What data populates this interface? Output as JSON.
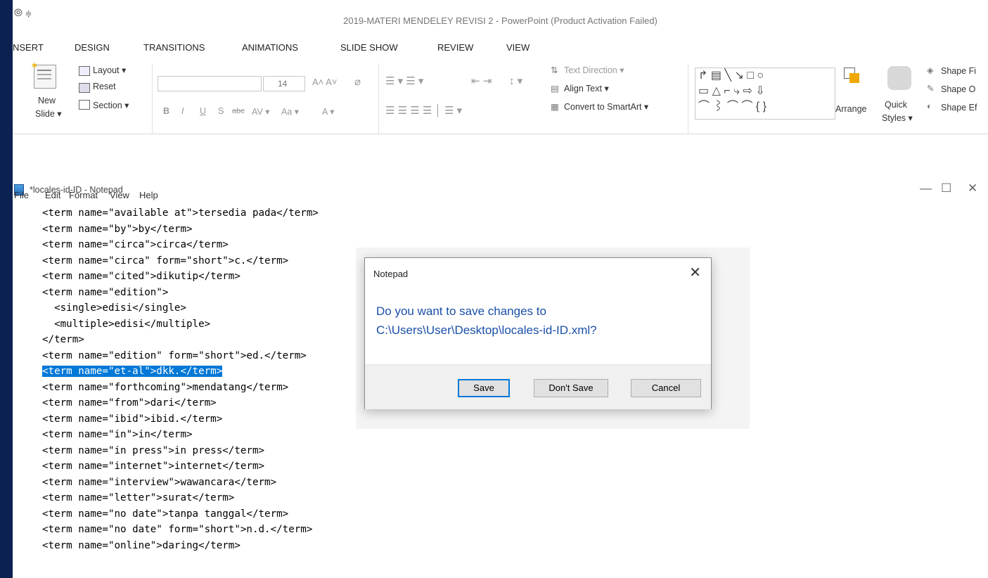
{
  "app": {
    "qat_glyph": "⦾ ≑",
    "window_title": "2019-MATERI MENDELEY REVISI 2 - PowerPoint (Product Activation Failed)"
  },
  "ribbon_tabs": [
    "NSERT",
    "DESIGN",
    "TRANSITIONS",
    "ANIMATIONS",
    "SLIDE SHOW",
    "REVIEW",
    "VIEW"
  ],
  "ribbon": {
    "new_slide": "New",
    "new_slide_2": "Slide ▾",
    "layout": "Layout ▾",
    "reset": "Reset",
    "section": "Section ▾",
    "font_size": "14",
    "font_grow": "A˄ A˅",
    "bold": "B",
    "italic": "I",
    "underline": "U",
    "strike": "S",
    "abc": "abc",
    "spacing": "AV ▾",
    "case": "Aa ▾",
    "font_color": "A ▾",
    "text_direction": "Text Direction ▾",
    "align_text": "Align Text ▾",
    "convert_smartart": "Convert to SmartArt ▾",
    "arrange": "Arrange",
    "quick": "Quick",
    "styles": "Styles ▾",
    "shape_fill": "Shape Fi",
    "shape_outline": "Shape O",
    "shape_effects": "Shape Ef"
  },
  "notepad": {
    "title": "*locales-id-ID - Notepad",
    "menu": [
      "File",
      "Edit",
      "Format",
      "View",
      "Help"
    ],
    "lines": [
      "<term name=\"available at\">tersedia pada</term>",
      "<term name=\"by\">by</term>",
      "<term name=\"circa\">circa</term>",
      "<term name=\"circa\" form=\"short\">c.</term>",
      "<term name=\"cited\">dikutip</term>",
      "<term name=\"edition\">",
      "  <single>edisi</single>",
      "  <multiple>edisi</multiple>",
      "</term>",
      "<term name=\"edition\" form=\"short\">ed.</term>",
      "<term name=\"et-al\">dkk.</term>",
      "<term name=\"forthcoming\">mendatang</term>",
      "<term name=\"from\">dari</term>",
      "<term name=\"ibid\">ibid.</term>",
      "<term name=\"in\">in</term>",
      "<term name=\"in press\">in press</term>",
      "<term name=\"internet\">internet</term>",
      "<term name=\"interview\">wawancara</term>",
      "<term name=\"letter\">surat</term>",
      "<term name=\"no date\">tanpa tanggal</term>",
      "<term name=\"no date\" form=\"short\">n.d.</term>",
      "<term name=\"online\">daring</term>"
    ],
    "selected_line": 10
  },
  "dialog": {
    "title": "Notepad",
    "message_line1": "Do you want to save changes to",
    "message_line2": "C:\\Users\\User\\Desktop\\locales-id-ID.xml?",
    "save": "Save",
    "dont_save": "Don't Save",
    "cancel": "Cancel"
  }
}
